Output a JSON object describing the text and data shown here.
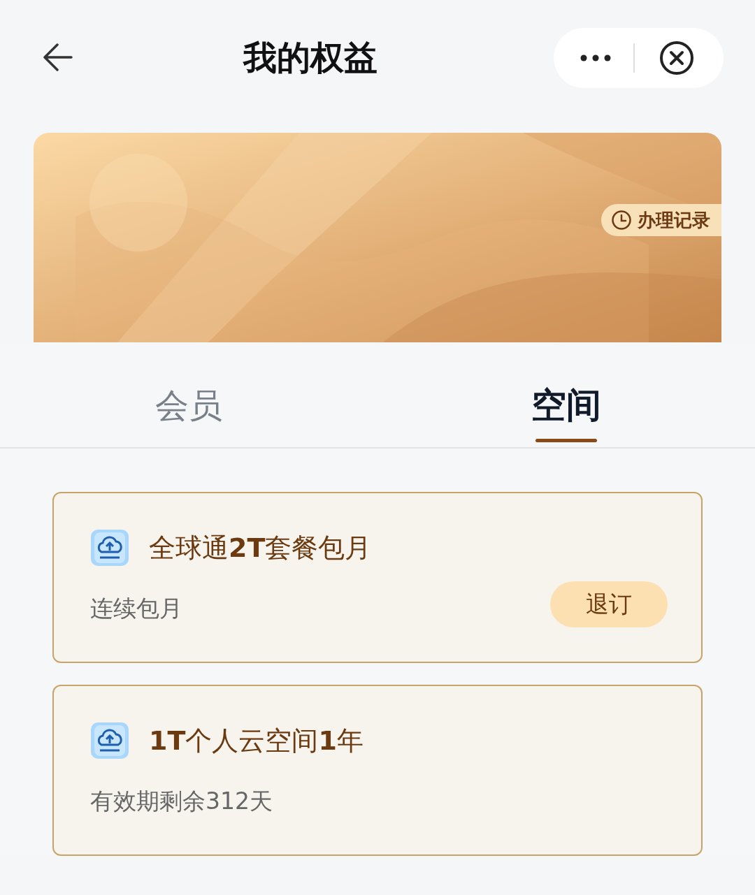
{
  "header": {
    "title": "我的权益"
  },
  "banner": {
    "kind": "picture",
    "record_button": "办理记录"
  },
  "tabs": [
    {
      "label": "会员",
      "selected": false
    },
    {
      "label": "空间",
      "selected": true
    }
  ],
  "items": [
    {
      "title": "全球通**2T**套餐包月",
      "subtitle": "连续包月",
      "action": "退订"
    },
    {
      "title": "**1T**个人云空间**1**年",
      "subtitle": "有效期剩余312天"
    }
  ]
}
